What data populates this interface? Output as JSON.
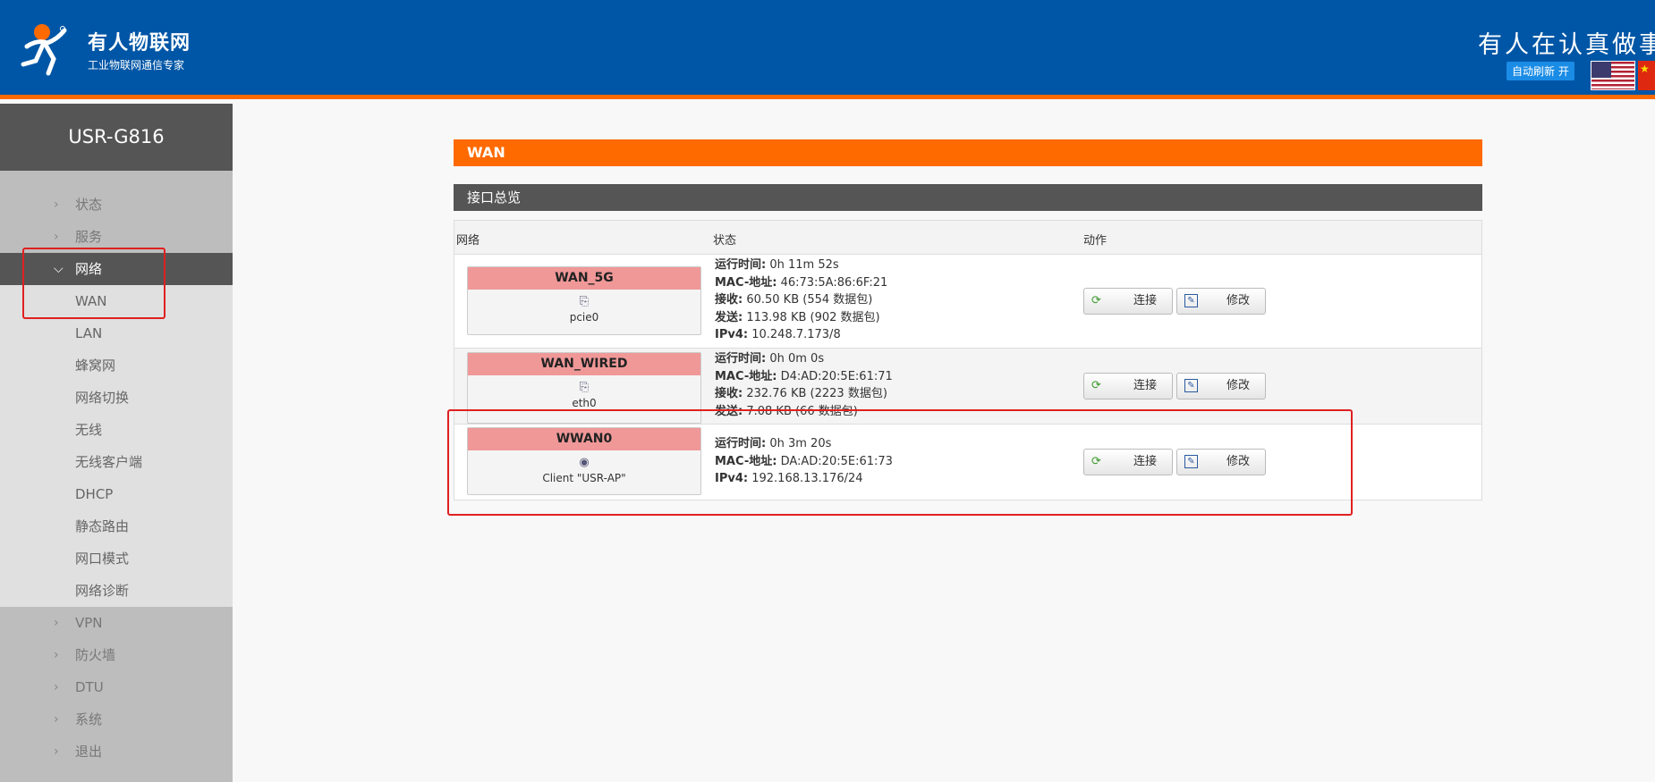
{
  "header": {
    "brand_name": "有人物联网",
    "brand_tagline": "工业物联网通信专家",
    "slogan": "有人在认真做事",
    "auto_refresh": "自动刷新 开",
    "flag_cn_star": "★"
  },
  "sidebar": {
    "device_name": "USR-G816",
    "items": [
      {
        "label": "状态"
      },
      {
        "label": "服务"
      },
      {
        "label": "网络"
      }
    ],
    "sub_items": [
      {
        "label": "WAN"
      },
      {
        "label": "LAN"
      },
      {
        "label": "蜂窝网"
      },
      {
        "label": "网络切换"
      },
      {
        "label": "无线"
      },
      {
        "label": "无线客户端"
      },
      {
        "label": "DHCP"
      },
      {
        "label": "静态路由"
      },
      {
        "label": "网口模式"
      },
      {
        "label": "网络诊断"
      }
    ],
    "items_after": [
      {
        "label": "VPN"
      },
      {
        "label": "防火墙"
      },
      {
        "label": "DTU"
      },
      {
        "label": "系统"
      },
      {
        "label": "退出"
      }
    ]
  },
  "main": {
    "page_title": "WAN",
    "section_title": "接口总览",
    "columns": {
      "network": "网络",
      "status": "状态",
      "action": "动作"
    },
    "buttons": {
      "connect": "连接",
      "edit": "修改"
    },
    "rows": [
      {
        "name": "WAN_5G",
        "device": "pcie0",
        "uptime_label": "运行时间:",
        "uptime": " 0h 11m 52s",
        "mac_label": "MAC-地址:",
        "mac": " 46:73:5A:86:6F:21",
        "rx_label": "接收:",
        "rx": " 60.50 KB (554 数据包)",
        "tx_label": "发送:",
        "tx": " 113.98 KB (902 数据包)",
        "ipv4_label": "IPv4:",
        "ipv4": " 10.248.7.173/8"
      },
      {
        "name": "WAN_WIRED",
        "device": "eth0",
        "uptime_label": "运行时间:",
        "uptime": " 0h 0m 0s",
        "mac_label": "MAC-地址:",
        "mac": " D4:AD:20:5E:61:71",
        "rx_label": "接收:",
        "rx": " 232.76 KB (2223 数据包)",
        "tx_label": "发送:",
        "tx": " 7.08 KB (66 数据包)"
      },
      {
        "name": "WWAN0",
        "device": "Client \"USR-AP\"",
        "uptime_label": "运行时间:",
        "uptime": " 0h 3m 20s",
        "mac_label": "MAC-地址:",
        "mac": " DA:AD:20:5E:61:73",
        "ipv4_label": "IPv4:",
        "ipv4": " 192.168.13.176/24"
      }
    ]
  },
  "colors": {
    "header_bg": "#0056a6",
    "accent_orange": "#ff6a00",
    "sidebar_dark": "#555555",
    "annotation_red": "#e02020"
  }
}
